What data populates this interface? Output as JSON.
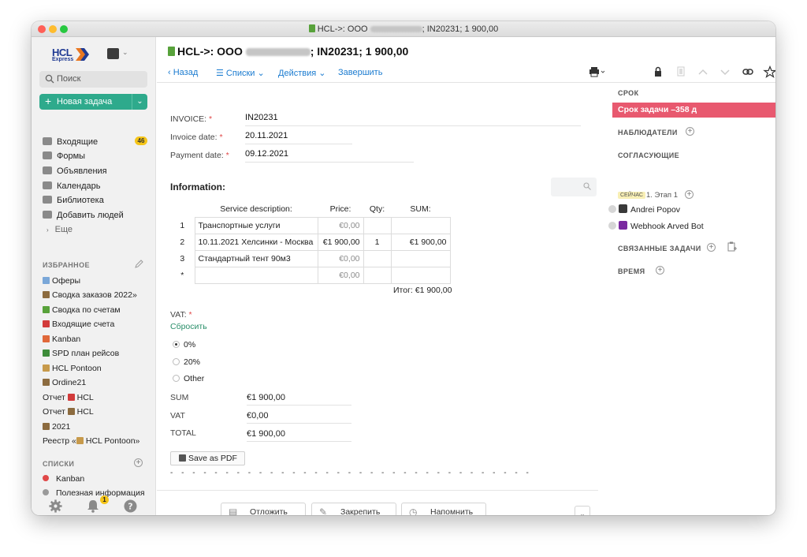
{
  "window": {
    "title_prefix": "HCL->: ООО",
    "title_suffix": "; IN20231; 1 900,00"
  },
  "sidebar": {
    "logo_text": "HCL",
    "logo_sub": "Express",
    "search_placeholder": "Поиск",
    "new_task_label": "Новая задача",
    "nav": [
      {
        "label": "Входящие",
        "icon": "inbox-icon"
      },
      {
        "label": "Формы",
        "icon": "forms-icon"
      },
      {
        "label": "Объявления",
        "icon": "megaphone-icon"
      },
      {
        "label": "Календарь",
        "icon": "calendar-icon"
      },
      {
        "label": "Библиотека",
        "icon": "library-icon"
      },
      {
        "label": "Добавить людей",
        "icon": "add-people-icon"
      },
      {
        "label": "Еще",
        "icon": "more-icon"
      }
    ],
    "inbox_badge": "46",
    "favorites_heading": "ИЗБРАННОЕ",
    "favorites": [
      {
        "label": "Оферы",
        "color": "#7aa7d8"
      },
      {
        "label": "Сводка заказов 2022»",
        "color": "#8c6b3f"
      },
      {
        "label": "Сводка по счетам",
        "color": "#58a23b"
      },
      {
        "label": "Входящие счета",
        "color": "#d23b3b"
      },
      {
        "label": "Kanban",
        "color": "#e0683a"
      },
      {
        "label": "SPD план рейсов",
        "color": "#3e8c3a"
      },
      {
        "label": "HCL Pontoon",
        "color": "#c79a4b"
      },
      {
        "label": "Ordine21",
        "color": "#8c6b3f"
      },
      {
        "label": "Отчет ",
        "label2": "HCL",
        "color": "#d23b3b"
      },
      {
        "label": "Отчет ",
        "label2": "HCL",
        "color": "#8c6b3f"
      },
      {
        "label": "2021",
        "color": "#8c6b3f"
      },
      {
        "label": "Реестр «",
        "label2": "HCL Pontoon»",
        "color": "#c79a4b"
      }
    ],
    "lists_heading": "СПИСКИ",
    "lists": [
      {
        "label": "Kanban",
        "color": "#e04848"
      },
      {
        "label": "Полезная информация",
        "color": "#9a9a9a"
      }
    ],
    "bell_badge": "1"
  },
  "header": {
    "title_prefix": "HCL->: ООО",
    "title_suffix": "; IN20231; 1 900,00",
    "back_label": "Назад",
    "lists_label": "Списки",
    "actions_label": "Действия",
    "finish_label": "Завершить"
  },
  "form": {
    "invoice_label": "INVOICE:",
    "invoice_value": "IN20231",
    "invoice_date_label": "Invoice date:",
    "invoice_date_value": "20.11.2021",
    "payment_date_label": "Payment date:",
    "payment_date_value": "09.12.2021",
    "info_heading": "Information:",
    "table": {
      "headers": [
        "Service description:",
        "Price:",
        "Qty:",
        "SUM:"
      ],
      "rows": [
        {
          "num": "1",
          "desc": "Транспортные услуги",
          "price": "€0,00",
          "qty": "",
          "sum": ""
        },
        {
          "num": "2",
          "desc": "10.11.2021 Хелсинки - Москва",
          "price": "€1 900,00",
          "qty": "1",
          "sum": "€1 900,00"
        },
        {
          "num": "3",
          "desc": "Стандартный тент 90м3",
          "price": "€0,00",
          "qty": "",
          "sum": ""
        },
        {
          "num": "*",
          "desc": "",
          "price": "€0,00",
          "qty": "",
          "sum": ""
        }
      ],
      "total": "Итог: €1 900,00"
    },
    "vat_label": "VAT:",
    "reset_label": "Сбросить",
    "vat_options": [
      "0%",
      "20%",
      "Other"
    ],
    "vat_selected": "0%",
    "sum_label": "SUM",
    "sum_value": "€1 900,00",
    "vat_row_label": "VAT",
    "vat_value": "€0,00",
    "total_label": "TOTAL",
    "total_value": "€1 900,00",
    "save_pdf_label": "Save as PDF",
    "dashes": "- - - - - - - - - - - - - - - - - - - - - - - - - - - - - - - - -"
  },
  "actions": {
    "postpone": "Отложить",
    "pin": "Закрепить",
    "remind": "Напомнить"
  },
  "right_panel": {
    "deadline_heading": "СРОК",
    "deadline_value": "Срок задачи –358 д",
    "watchers_heading": "НАБЛЮДАТЕЛИ",
    "approvers_heading": "СОГЛАСУЮЩИЕ",
    "stage_badge": "СЕЙЧАС",
    "stage_label": "1. Этап 1",
    "people": [
      "Andrei Popov",
      "Webhook Arved Bot"
    ],
    "related_heading": "СВЯЗАННЫЕ ЗАДАЧИ",
    "time_heading": "ВРЕМЯ"
  }
}
